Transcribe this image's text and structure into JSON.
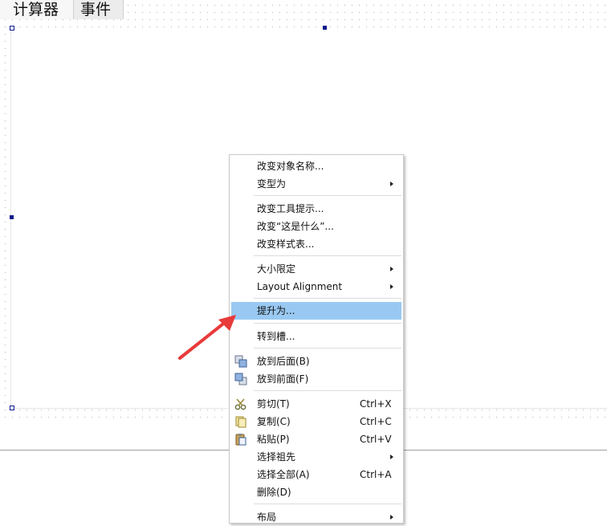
{
  "tabs": [
    {
      "label": "计算器"
    },
    {
      "label": "事件"
    }
  ],
  "menu": {
    "items": [
      {
        "label": "改变对象名称..."
      },
      {
        "label": "变型为"
      },
      {
        "label": "改变工具提示..."
      },
      {
        "label": "改变“这是什么”..."
      },
      {
        "label": "改变样式表..."
      },
      {
        "label": "大小限定"
      },
      {
        "label": "Layout Alignment"
      },
      {
        "label": "提升为..."
      },
      {
        "label": "转到槽..."
      },
      {
        "label": "放到后面(B)"
      },
      {
        "label": "放到前面(F)"
      },
      {
        "label": "剪切(T)",
        "shortcut": "Ctrl+X"
      },
      {
        "label": "复制(C)",
        "shortcut": "Ctrl+C"
      },
      {
        "label": "粘贴(P)",
        "shortcut": "Ctrl+V"
      },
      {
        "label": "选择祖先"
      },
      {
        "label": "选择全部(A)",
        "shortcut": "Ctrl+A"
      },
      {
        "label": "删除(D)"
      },
      {
        "label": "布局"
      }
    ]
  },
  "colors": {
    "highlight": "#99c9f2",
    "handle": "#0a1a8a",
    "annotation_arrow": "#e83a3a"
  },
  "icons": [
    "send-to-back-icon",
    "bring-to-front-icon",
    "cut-icon",
    "copy-icon",
    "paste-icon"
  ]
}
